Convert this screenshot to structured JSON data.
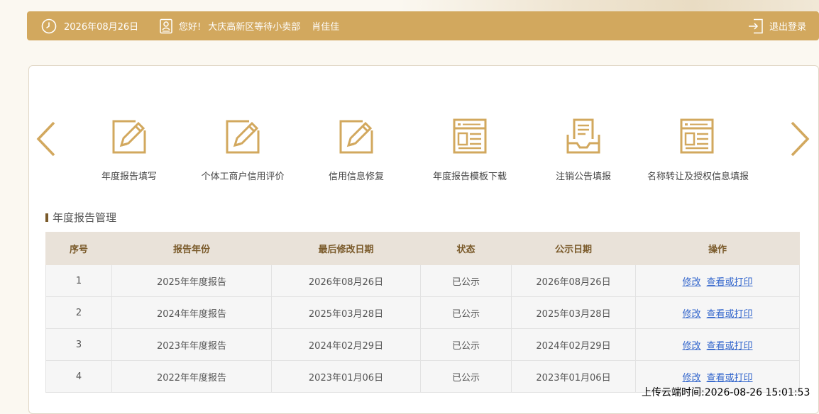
{
  "header": {
    "date": "2026年08月26日",
    "greeting": "您好!",
    "organization": "大庆高新区等待小卖部",
    "user_name": "肖佳佳",
    "logout_label": "退出登录"
  },
  "functions": [
    {
      "label": "年度报告填写",
      "icon": "edit-icon"
    },
    {
      "label": "个体工商户信用评价",
      "icon": "edit-icon"
    },
    {
      "label": "信用信息修复",
      "icon": "edit-icon"
    },
    {
      "label": "年度报告模板下载",
      "icon": "template-icon"
    },
    {
      "label": "注销公告填报",
      "icon": "inbox-icon"
    },
    {
      "label": "名称转让及授权信息填报",
      "icon": "template-icon"
    }
  ],
  "section": {
    "title": "年度报告管理"
  },
  "table": {
    "headers": [
      "序号",
      "报告年份",
      "最后修改日期",
      "状态",
      "公示日期",
      "操作"
    ],
    "rows": [
      {
        "index": "1",
        "year": "2025年年度报告",
        "modified": "2026年08月26日",
        "status": "已公示",
        "publish": "2026年08月26日",
        "edit": "修改",
        "view": "查看或打印"
      },
      {
        "index": "2",
        "year": "2024年年度报告",
        "modified": "2025年03月28日",
        "status": "已公示",
        "publish": "2025年03月28日",
        "edit": "修改",
        "view": "查看或打印"
      },
      {
        "index": "3",
        "year": "2023年年度报告",
        "modified": "2024年02月29日",
        "status": "已公示",
        "publish": "2024年02月29日",
        "edit": "修改",
        "view": "查看或打印"
      },
      {
        "index": "4",
        "year": "2022年年度报告",
        "modified": "2023年01月06日",
        "status": "已公示",
        "publish": "2023年01月06日",
        "edit": "修改",
        "view": "查看或打印"
      }
    ]
  },
  "footer": {
    "upload_time": "上传云端时间:2026-08-26 15:01:53"
  },
  "colors": {
    "accent": "#d2a85e",
    "header_text": "#7a5a2a",
    "link": "#3366cc"
  }
}
